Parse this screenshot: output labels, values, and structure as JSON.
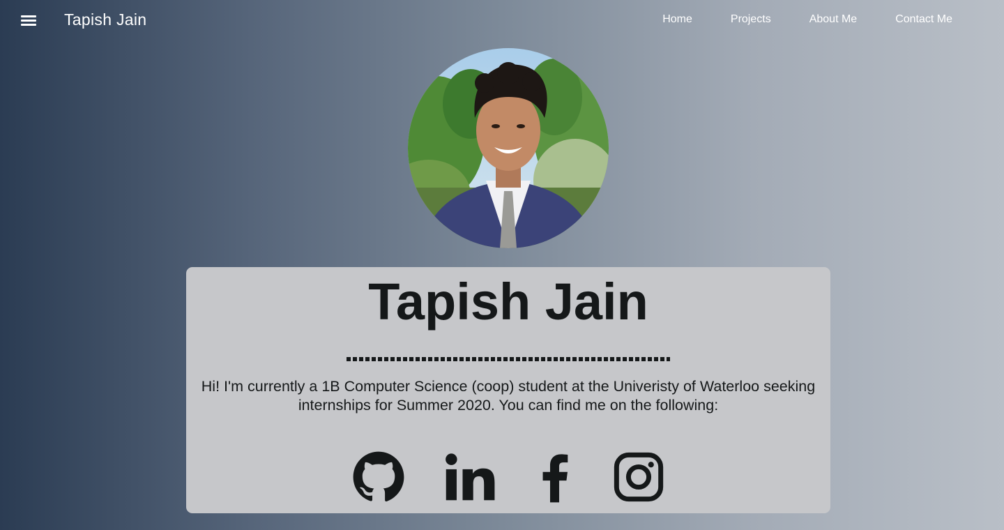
{
  "header": {
    "brand": "Tapish Jain",
    "menu_icon": "hamburger-menu-icon",
    "nav": [
      {
        "label": "Home"
      },
      {
        "label": "Projects"
      },
      {
        "label": "About Me"
      },
      {
        "label": "Contact Me"
      }
    ]
  },
  "profile": {
    "name": "Tapish Jain",
    "bio": "Hi! I'm currently a 1B Computer Science (coop) student at the Univeristy of Waterloo seeking internships for Summer 2020. You can find me on the following:",
    "socials": [
      {
        "icon": "github-icon"
      },
      {
        "icon": "linkedin-icon"
      },
      {
        "icon": "facebook-icon"
      },
      {
        "icon": "instagram-icon"
      }
    ]
  },
  "colors": {
    "text_dark": "#151819",
    "card_bg": "#c6c7ca",
    "gradient_start": "#2b3c53",
    "gradient_end": "#b9bfc7",
    "nav_text": "#ffffff"
  }
}
